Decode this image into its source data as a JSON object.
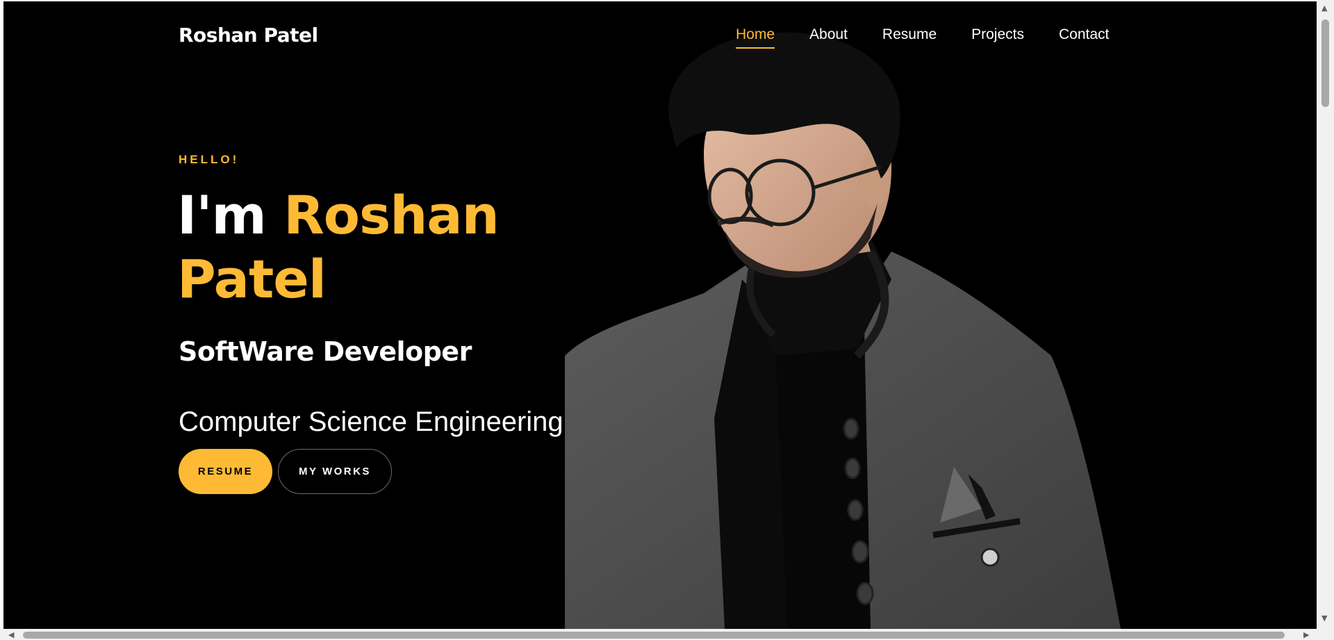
{
  "header": {
    "brand": "Roshan Patel",
    "nav": [
      {
        "label": "Home",
        "active": true
      },
      {
        "label": "About",
        "active": false
      },
      {
        "label": "Resume",
        "active": false
      },
      {
        "label": "Projects",
        "active": false
      },
      {
        "label": "Contact",
        "active": false
      }
    ]
  },
  "hero": {
    "greeting": "HELLO!",
    "intro": "I'm",
    "name_first": "Roshan",
    "name_last": "Patel",
    "role": "SoftWare Developer",
    "field": "Computer Science Engineering",
    "buttons": {
      "resume": "RESUME",
      "works": "MY WORKS"
    },
    "portrait_icon": "person-portrait-illustration"
  },
  "colors": {
    "background": "#000000",
    "accent": "#ffba35",
    "text": "#ffffff"
  }
}
